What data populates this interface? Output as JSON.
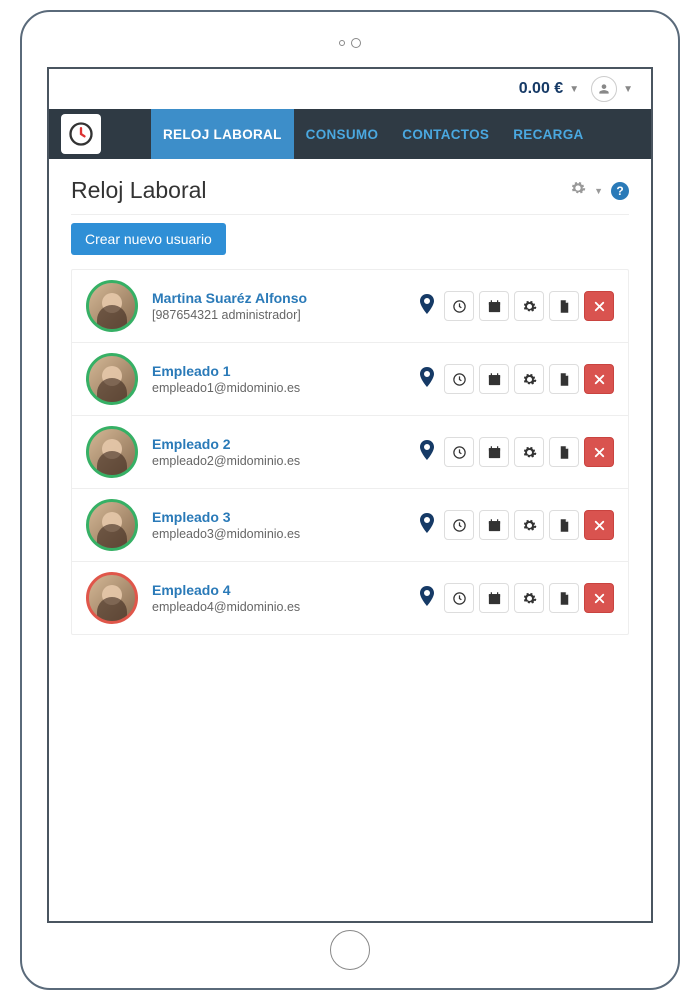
{
  "topbar": {
    "balance": "0.00 €"
  },
  "nav": {
    "items": [
      {
        "label": "RELOJ LABORAL",
        "active": true
      },
      {
        "label": "CONSUMO",
        "active": false
      },
      {
        "label": "CONTACTOS",
        "active": false
      },
      {
        "label": "RECARGA",
        "active": false
      }
    ]
  },
  "page": {
    "title": "Reloj Laboral",
    "create_button": "Crear nuevo usuario"
  },
  "users": [
    {
      "name": "Martina Suaréz Alfonso",
      "sub": "[987654321 administrador]",
      "ring": "green"
    },
    {
      "name": "Empleado 1",
      "sub": "empleado1@midominio.es",
      "ring": "green"
    },
    {
      "name": "Empleado 2",
      "sub": "empleado2@midominio.es",
      "ring": "green"
    },
    {
      "name": "Empleado 3",
      "sub": "empleado3@midominio.es",
      "ring": "green"
    },
    {
      "name": "Empleado 4",
      "sub": "empleado4@midominio.es",
      "ring": "red"
    }
  ],
  "icons": {
    "location": "location-pin-icon",
    "clock": "clock-icon",
    "calendar": "calendar-icon",
    "gear": "gear-icon",
    "document": "document-icon",
    "delete": "close-icon"
  }
}
